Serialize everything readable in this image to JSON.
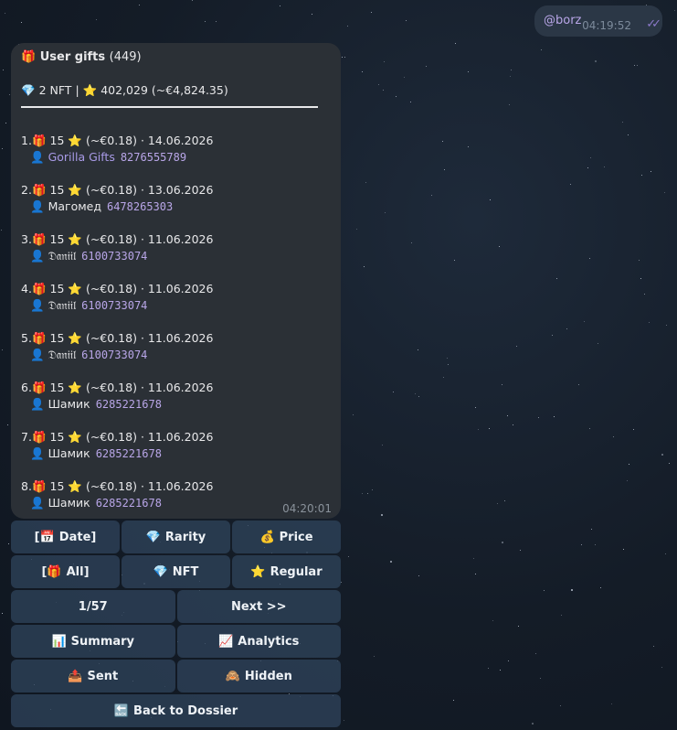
{
  "outgoing": {
    "text": "@borz",
    "time": "04:19:52",
    "ticks": "✓✓"
  },
  "message": {
    "gift_icon": "🎁",
    "title": "User gifts",
    "count": "(449)",
    "summary_gem_icon": "💎",
    "summary_nft": "2 NFT",
    "summary_sep": "|",
    "summary_star_icon": "⭐",
    "summary_stars": "402,029 (~€4,824.35)",
    "time": "04:20:01",
    "user_icon": "👤",
    "gifts": [
      {
        "num": "1.",
        "stars": "15",
        "rest": "(~€0.18) · 14.06.2026",
        "user": "Gorilla Gifts",
        "id": "8276555789",
        "link": true
      },
      {
        "num": "2.",
        "stars": "15",
        "rest": "(~€0.18) · 13.06.2026",
        "user": "Магомед",
        "id": "6478265303",
        "link": false
      },
      {
        "num": "3.",
        "stars": "15",
        "rest": "(~€0.18) · 11.06.2026",
        "user": "𝔇𝔞𝔫𝔦𝔦𝔩",
        "id": "6100733074",
        "link": false
      },
      {
        "num": "4.",
        "stars": "15",
        "rest": "(~€0.18) · 11.06.2026",
        "user": "𝔇𝔞𝔫𝔦𝔦𝔩",
        "id": "6100733074",
        "link": false
      },
      {
        "num": "5.",
        "stars": "15",
        "rest": "(~€0.18) · 11.06.2026",
        "user": "𝔇𝔞𝔫𝔦𝔦𝔩",
        "id": "6100733074",
        "link": false
      },
      {
        "num": "6.",
        "stars": "15",
        "rest": "(~€0.18) · 11.06.2026",
        "user": "Шамик",
        "id": "6285221678",
        "link": false
      },
      {
        "num": "7.",
        "stars": "15",
        "rest": "(~€0.18) · 11.06.2026",
        "user": "Шамик",
        "id": "6285221678",
        "link": false
      },
      {
        "num": "8.",
        "stars": "15",
        "rest": "(~€0.18) · 11.06.2026",
        "user": "Шамик",
        "id": "6285221678",
        "link": false
      }
    ]
  },
  "keyboard": [
    [
      {
        "name": "date-sort",
        "pre": "[",
        "icon": "📅",
        "label": "Date]"
      },
      {
        "name": "rarity-sort",
        "pre": "",
        "icon": "💎",
        "label": "Rarity"
      },
      {
        "name": "price-sort",
        "pre": "",
        "icon": "💰",
        "label": "Price"
      }
    ],
    [
      {
        "name": "filter-all",
        "pre": "[",
        "icon": "🎁",
        "label": "All]"
      },
      {
        "name": "filter-nft",
        "pre": "",
        "icon": "💎",
        "label": "NFT"
      },
      {
        "name": "filter-regular",
        "pre": "",
        "icon": "⭐",
        "label": "Regular"
      }
    ],
    [
      {
        "name": "page-indicator",
        "pre": "",
        "icon": "",
        "label": "1/57"
      },
      {
        "name": "next-page",
        "pre": "",
        "icon": "",
        "label": "Next >>"
      }
    ],
    [
      {
        "name": "summary",
        "pre": "",
        "icon": "📊",
        "label": "Summary"
      },
      {
        "name": "analytics",
        "pre": "",
        "icon": "📈",
        "label": "Analytics"
      }
    ],
    [
      {
        "name": "sent",
        "pre": "",
        "icon": "📤",
        "label": "Sent"
      },
      {
        "name": "hidden",
        "pre": "",
        "icon": "🙈",
        "label": "Hidden"
      }
    ],
    [
      {
        "name": "back-to-dossier",
        "pre": "",
        "icon": "🔙",
        "label": "Back to Dossier"
      }
    ]
  ],
  "colors": {
    "bubble": "#2b3036",
    "link": "#a89ae6",
    "button": "#2e425a",
    "accent": "#b9a6e8"
  }
}
